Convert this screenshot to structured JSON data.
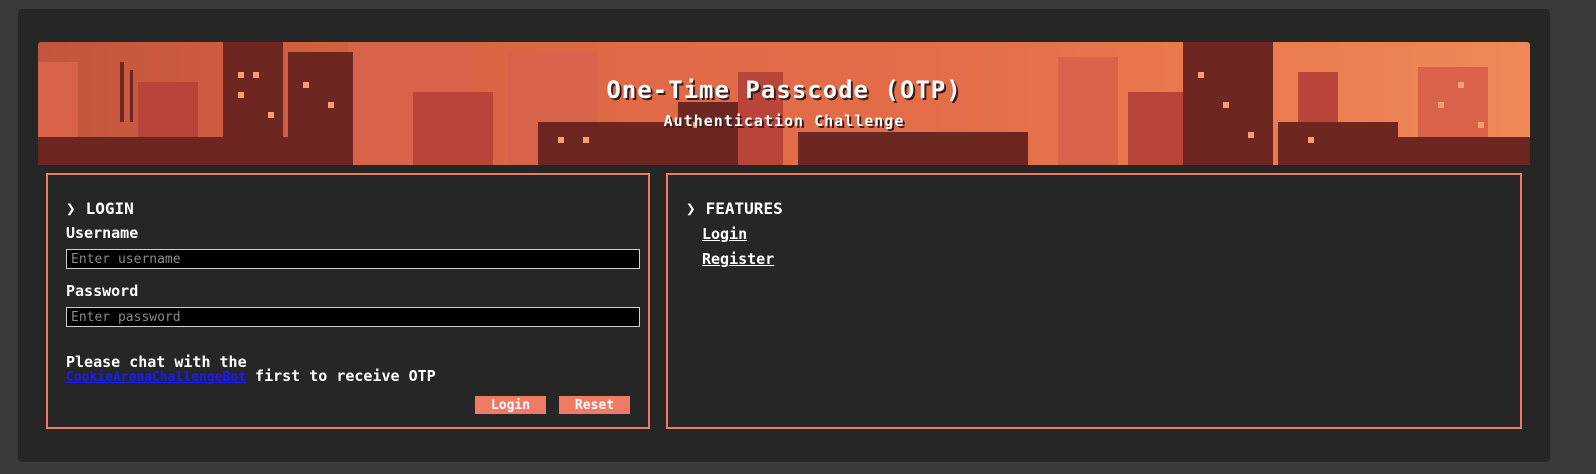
{
  "banner": {
    "title": "One-Time Passcode (OTP)",
    "subtitle": "Authentication Challenge"
  },
  "login": {
    "heading": "LOGIN",
    "username_label": "Username",
    "username_placeholder": "Enter username",
    "username_value": "",
    "password_label": "Password",
    "password_placeholder": "Enter password",
    "password_value": "",
    "note_prefix": "Please chat with the",
    "bot_link": "CookieArenaChallengeBot",
    "note_suffix": " first to receive OTP",
    "login_button": "Login",
    "reset_button": "Reset"
  },
  "features": {
    "heading": "FEATURES",
    "links": [
      "Login",
      "Register"
    ]
  },
  "colors": {
    "page_bg": "#3a3a3a",
    "card_bg": "#262626",
    "accent": "#f07a63",
    "link": "#1a1aff"
  },
  "icons": {
    "heading_marker": "chevron-right-icon"
  }
}
